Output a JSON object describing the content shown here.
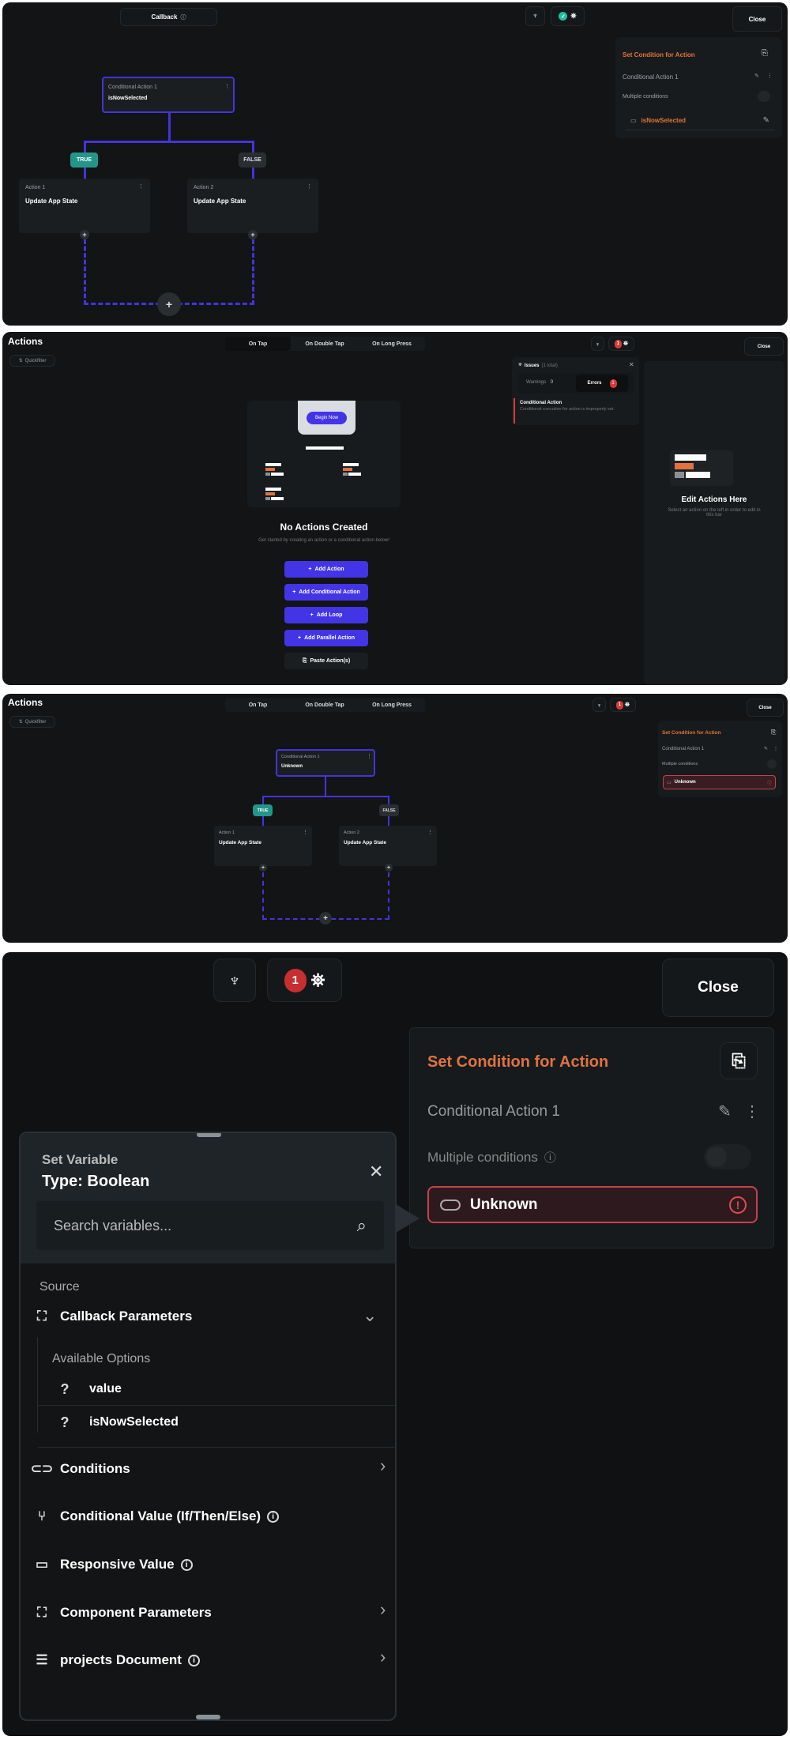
{
  "colors": {
    "accent": "#4434d8",
    "true": "#249689",
    "orange": "#e0733e",
    "error": "#d93b3b"
  },
  "p1": {
    "tab": "Callback",
    "close": "Close",
    "right": {
      "title": "Set Condition for Action",
      "name": "Conditional Action 1",
      "multiple": "Multiple conditions",
      "condition": "isNowSelected"
    },
    "cond": {
      "label": "Conditional Action 1",
      "value": "isNowSelected"
    },
    "true": "TRUE",
    "false": "FALSE",
    "a1": {
      "label": "Action 1",
      "value": "Update App State"
    },
    "a2": {
      "label": "Action 2",
      "value": "Update App State"
    }
  },
  "p2": {
    "title": "Actions",
    "tabs": [
      "On Tap",
      "On Double Tap",
      "On Long Press"
    ],
    "quickfilter": "Quickfilter",
    "close": "Close",
    "error_count": "1",
    "issues": {
      "title": "Issues",
      "total": "(1 total)",
      "warnings": "Warnings",
      "warnings_count": "0",
      "errors": "Errors",
      "errors_count": "1",
      "item_title": "Conditional Action",
      "item_desc": "Conditional execution for action is improperly set."
    },
    "begin": "Begin Now",
    "empty_title": "No Actions Created",
    "empty_desc": "Get started by creating an action or a conditional action below!",
    "buttons": [
      "Add Action",
      "Add Conditional Action",
      "Add Loop",
      "Add Parallel Action"
    ],
    "paste": "Paste Action(s)",
    "edit_title": "Edit Actions Here",
    "edit_desc": "Select an action on the left in order to edit in this bar"
  },
  "p3": {
    "title": "Actions",
    "tabs": [
      "On Tap",
      "On Double Tap",
      "On Long Press"
    ],
    "quickfilter": "Quickfilter",
    "close": "Close",
    "error_count": "1",
    "right": {
      "title": "Set Condition for Action",
      "name": "Conditional Action 1",
      "multiple": "Multiple conditions",
      "condition": "Unknown"
    },
    "cond": {
      "label": "Conditional Action 1",
      "value": "Unknown"
    },
    "true": "TRUE",
    "false": "FALSE",
    "a1": {
      "label": "Action 1",
      "value": "Update App State"
    },
    "a2": {
      "label": "Action 2",
      "value": "Update App State"
    }
  },
  "p4": {
    "error_count": "1",
    "close": "Close",
    "right": {
      "title": "Set Condition for Action",
      "name": "Conditional Action 1",
      "multiple": "Multiple conditions",
      "condition": "Unknown"
    },
    "popup": {
      "title": "Set Variable",
      "type": "Type: Boolean",
      "search_placeholder": "Search variables...",
      "source": "Source",
      "callback": "Callback Parameters",
      "available": "Available Options",
      "options": [
        "value",
        "isNowSelected"
      ],
      "items": [
        "Conditions",
        "Conditional Value (If/Then/Else)",
        "Responsive Value",
        "Component Parameters",
        "projects Document"
      ]
    }
  }
}
